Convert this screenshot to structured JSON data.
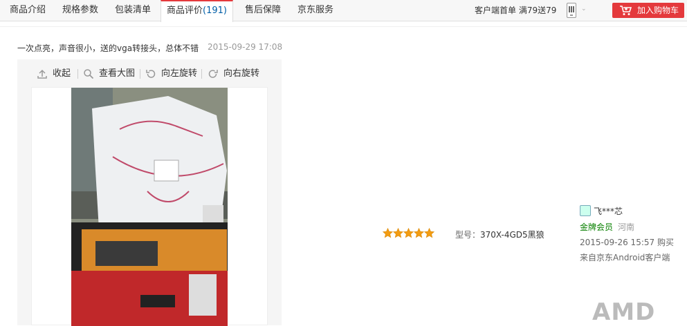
{
  "tabs": [
    {
      "label": "商品介绍"
    },
    {
      "label": "规格参数"
    },
    {
      "label": "包装清单"
    },
    {
      "label": "商品评价",
      "count": "(191)",
      "active": true
    },
    {
      "label": "售后保障"
    },
    {
      "label": "京东服务"
    }
  ],
  "header": {
    "promo": "客户端首单 满79送79",
    "cart_button": "加入购物车"
  },
  "comment": {
    "text": "一次点亮，声音很小，送的vga转接头，总体不错",
    "time": "2015-09-29 17:08",
    "toolbar": {
      "collapse": "收起",
      "view_large": "查看大图",
      "rotate_left": "向左旋转",
      "rotate_right": "向右旋转"
    },
    "rating_stars": 5,
    "model_label": "型号：",
    "model_value": "370X-4GD5黑狼",
    "user": {
      "name": "飞***芯",
      "level": "金牌会员",
      "region": "河南",
      "buy_time": "2015-09-26 15:57 购买",
      "source": "来自京东Android客户端"
    }
  },
  "watermark": "AMD",
  "colors": {
    "accent": "#e4393c",
    "link": "#005ea7",
    "member": "#088000",
    "star": "#f39c12"
  }
}
